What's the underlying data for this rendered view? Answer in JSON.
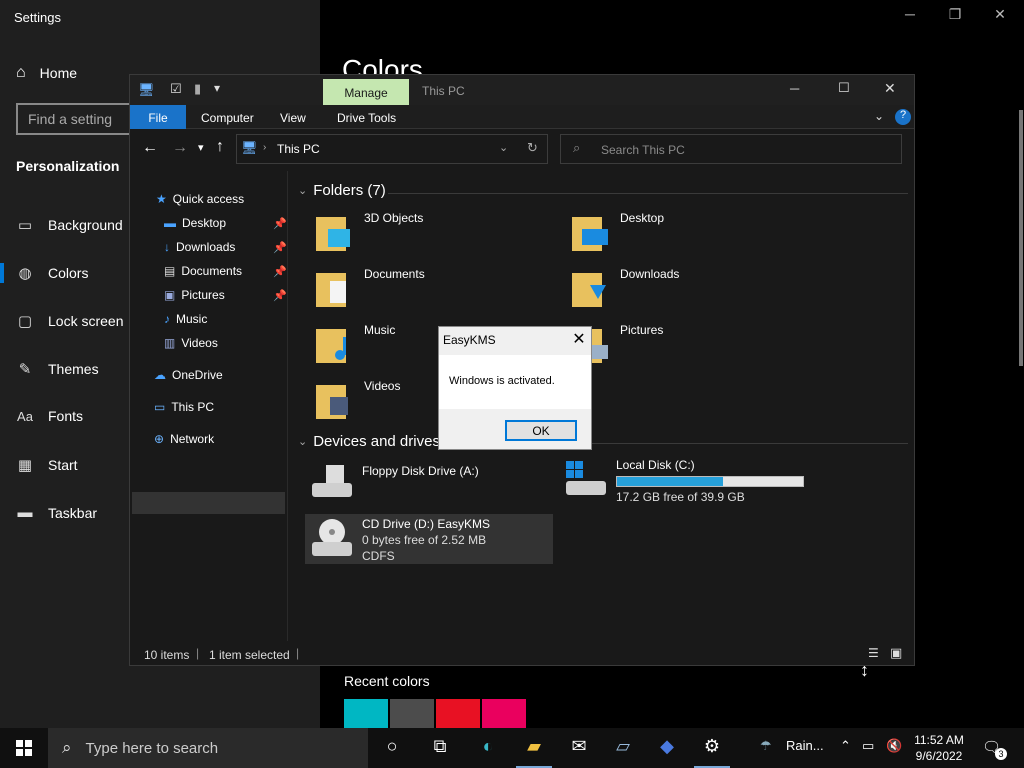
{
  "settings": {
    "title": "Settings",
    "home": "Home",
    "find_placeholder": "Find a setting",
    "section": "Personalization",
    "nav": [
      "Background",
      "Colors",
      "Lock screen",
      "Themes",
      "Fonts",
      "Start",
      "Taskbar"
    ],
    "page_heading": "Colors",
    "recent_colors_label": "Recent colors",
    "recent_colors": [
      "#00b7c3",
      "#4c4c4c",
      "#e81123",
      "#ea005e"
    ]
  },
  "explorer": {
    "manage_tab": "Manage",
    "title": "This PC",
    "ribbon_tabs": [
      "File",
      "Computer",
      "View",
      "Drive Tools"
    ],
    "address": "This PC",
    "search_placeholder": "Search This PC",
    "nav": {
      "quick_access": "Quick access",
      "pinned": [
        "Desktop",
        "Downloads",
        "Documents",
        "Pictures"
      ],
      "unpinned": [
        "Music",
        "Videos"
      ],
      "onedrive": "OneDrive",
      "this_pc": "This PC",
      "network": "Network"
    },
    "folders_header": "Folders (7)",
    "folders": [
      "3D Objects",
      "Desktop",
      "Documents",
      "Downloads",
      "Music",
      "Pictures",
      "Videos"
    ],
    "devices_header": "Devices and drives (3)",
    "drives": {
      "floppy": {
        "name": "Floppy Disk Drive (A:)"
      },
      "local": {
        "name": "Local Disk (C:)",
        "free": "17.2 GB free of 39.9 GB",
        "used_fraction": 0.57
      },
      "cd": {
        "name": "CD Drive (D:) EasyKMS",
        "free": "0 bytes free of 2.52 MB",
        "fs": "CDFS"
      }
    },
    "status": {
      "items": "10 items",
      "selected": "1 item selected"
    }
  },
  "dialog": {
    "title": "EasyKMS",
    "message": "Windows is activated.",
    "ok": "OK"
  },
  "taskbar": {
    "search_placeholder": "Type here to search",
    "weather": "Rain...",
    "time": "11:52 AM",
    "date": "9/6/2022",
    "notifications": "3"
  }
}
